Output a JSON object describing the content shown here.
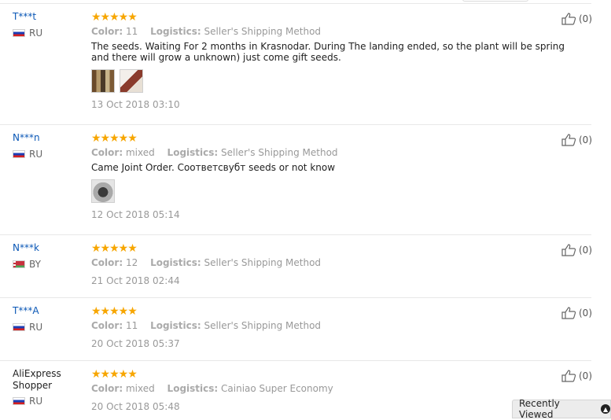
{
  "reviews": [
    {
      "user": "T***t",
      "country": "RU",
      "stars": "★★★★★",
      "color_label": "Color:",
      "color_value": "11",
      "logistics_label": "Logistics:",
      "logistics_value": "Seller's Shipping Method",
      "text": "The seeds. Waiting For 2 months in Krasnodar. During The landing ended, so the plant will be spring and there will grow a unknown) just come gift seeds.",
      "date": "13 Oct 2018 03:10",
      "likes": "(0)"
    },
    {
      "user": "N***n",
      "country": "RU",
      "stars": "★★★★★",
      "color_label": "Color:",
      "color_value": "mixed",
      "logistics_label": "Logistics:",
      "logistics_value": "Seller's Shipping Method",
      "text": "Came Joint Order. Соответсвубт seeds or not know",
      "date": "12 Oct 2018 05:14",
      "likes": "(0)"
    },
    {
      "user": "N***k",
      "country": "BY",
      "stars": "★★★★★",
      "color_label": "Color:",
      "color_value": "12",
      "logistics_label": "Logistics:",
      "logistics_value": "Seller's Shipping Method",
      "date": "21 Oct 2018 02:44",
      "likes": "(0)"
    },
    {
      "user": "T***A",
      "country": "RU",
      "stars": "★★★★★",
      "color_label": "Color:",
      "color_value": "11",
      "logistics_label": "Logistics:",
      "logistics_value": "Seller's Shipping Method",
      "date": "20 Oct 2018 05:37",
      "likes": "(0)"
    },
    {
      "user_line1": "AliExpress",
      "user_line2": "Shopper",
      "country": "RU",
      "stars": "★★★★★",
      "color_label": "Color:",
      "color_value": "mixed",
      "logistics_label": "Logistics:",
      "logistics_value": "Cainiao Super Economy",
      "date": "20 Oct 2018 05:48",
      "likes": "(0)"
    }
  ],
  "recently_viewed": {
    "label": "Recently Viewed",
    "icon": "chevron-up-icon"
  },
  "colors": {
    "username": "#0a57b6",
    "stars": "#f7a600",
    "meta": "#999999"
  }
}
